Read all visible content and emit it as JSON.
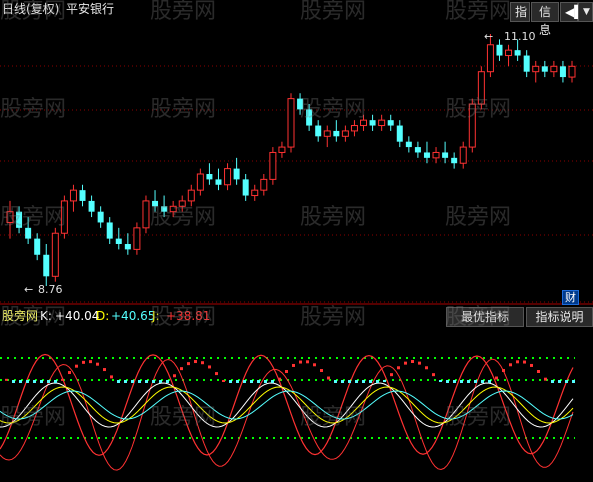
{
  "window": {
    "title": "日线(复权)",
    "stock_name": "平安银行"
  },
  "toolbar": {
    "indicator_label": "指",
    "info_label": "信息",
    "arrow_left_icon": "left-arrow-icon",
    "dropdown_icon": "chevron-down-icon"
  },
  "colors": {
    "background": "#000000",
    "up_candle": "#ff3232",
    "down_candle": "#54ffff",
    "grid": "#8b0000",
    "k_line": "#ffffff",
    "d_line": "#ffff00",
    "j_line": "#ff3232",
    "d_line2": "#54ffff"
  },
  "price_panel": {
    "high_label": "11.10",
    "low_label": "8.76",
    "badge_label": "财"
  },
  "indicator_panel": {
    "name": "股旁网",
    "k_label": "K:",
    "k_value": "+40.04",
    "d_label": "D:",
    "d_value": "+40.65",
    "j_label": "J:",
    "j_value": "+38.81",
    "best_button": "最优指标",
    "help_button": "指标说明"
  },
  "watermark": "股旁网",
  "chart_data": {
    "type": "candlestick",
    "low_price": 8.76,
    "high_price": 11.1,
    "candles": [
      [
        9.35,
        9.55,
        9.2,
        9.45
      ],
      [
        9.45,
        9.5,
        9.25,
        9.3
      ],
      [
        9.3,
        9.4,
        9.15,
        9.2
      ],
      [
        9.2,
        9.25,
        9.0,
        9.05
      ],
      [
        9.05,
        9.15,
        8.76,
        8.85
      ],
      [
        8.85,
        9.3,
        8.8,
        9.25
      ],
      [
        9.25,
        9.6,
        9.2,
        9.55
      ],
      [
        9.55,
        9.7,
        9.45,
        9.65
      ],
      [
        9.65,
        9.7,
        9.5,
        9.55
      ],
      [
        9.55,
        9.6,
        9.4,
        9.45
      ],
      [
        9.45,
        9.5,
        9.3,
        9.35
      ],
      [
        9.35,
        9.4,
        9.15,
        9.2
      ],
      [
        9.2,
        9.3,
        9.1,
        9.15
      ],
      [
        9.15,
        9.25,
        9.05,
        9.1
      ],
      [
        9.1,
        9.35,
        9.05,
        9.3
      ],
      [
        9.3,
        9.6,
        9.25,
        9.55
      ],
      [
        9.55,
        9.65,
        9.45,
        9.5
      ],
      [
        9.5,
        9.6,
        9.4,
        9.45
      ],
      [
        9.45,
        9.55,
        9.4,
        9.5
      ],
      [
        9.5,
        9.6,
        9.45,
        9.55
      ],
      [
        9.55,
        9.7,
        9.5,
        9.65
      ],
      [
        9.65,
        9.85,
        9.6,
        9.8
      ],
      [
        9.8,
        9.9,
        9.7,
        9.75
      ],
      [
        9.75,
        9.85,
        9.65,
        9.7
      ],
      [
        9.7,
        9.9,
        9.65,
        9.85
      ],
      [
        9.85,
        9.95,
        9.7,
        9.75
      ],
      [
        9.75,
        9.8,
        9.55,
        9.6
      ],
      [
        9.6,
        9.7,
        9.55,
        9.65
      ],
      [
        9.65,
        9.8,
        9.6,
        9.75
      ],
      [
        9.75,
        10.05,
        9.7,
        10.0
      ],
      [
        10.0,
        10.1,
        9.95,
        10.05
      ],
      [
        10.05,
        10.55,
        10.0,
        10.5
      ],
      [
        10.5,
        10.55,
        10.35,
        10.4
      ],
      [
        10.4,
        10.45,
        10.2,
        10.25
      ],
      [
        10.25,
        10.3,
        10.1,
        10.15
      ],
      [
        10.15,
        10.25,
        10.05,
        10.2
      ],
      [
        10.2,
        10.3,
        10.1,
        10.15
      ],
      [
        10.15,
        10.25,
        10.1,
        10.2
      ],
      [
        10.2,
        10.3,
        10.15,
        10.25
      ],
      [
        10.25,
        10.35,
        10.2,
        10.3
      ],
      [
        10.3,
        10.35,
        10.2,
        10.25
      ],
      [
        10.25,
        10.35,
        10.2,
        10.3
      ],
      [
        10.3,
        10.35,
        10.2,
        10.25
      ],
      [
        10.25,
        10.3,
        10.05,
        10.1
      ],
      [
        10.1,
        10.15,
        10.0,
        10.05
      ],
      [
        10.05,
        10.1,
        9.95,
        10.0
      ],
      [
        10.0,
        10.1,
        9.9,
        9.95
      ],
      [
        9.95,
        10.05,
        9.9,
        10.0
      ],
      [
        10.0,
        10.1,
        9.9,
        9.95
      ],
      [
        9.95,
        10.0,
        9.85,
        9.9
      ],
      [
        9.9,
        10.1,
        9.85,
        10.05
      ],
      [
        10.05,
        10.5,
        10.0,
        10.45
      ],
      [
        10.45,
        10.8,
        10.4,
        10.75
      ],
      [
        10.75,
        11.1,
        10.7,
        11.0
      ],
      [
        11.0,
        11.05,
        10.85,
        10.9
      ],
      [
        10.9,
        11.0,
        10.8,
        10.95
      ],
      [
        10.95,
        11.05,
        10.85,
        10.9
      ],
      [
        10.9,
        10.95,
        10.7,
        10.75
      ],
      [
        10.75,
        10.85,
        10.65,
        10.8
      ],
      [
        10.8,
        10.85,
        10.7,
        10.75
      ],
      [
        10.75,
        10.85,
        10.7,
        10.8
      ],
      [
        10.8,
        10.85,
        10.65,
        10.7
      ],
      [
        10.7,
        10.85,
        10.65,
        10.8
      ]
    ]
  }
}
